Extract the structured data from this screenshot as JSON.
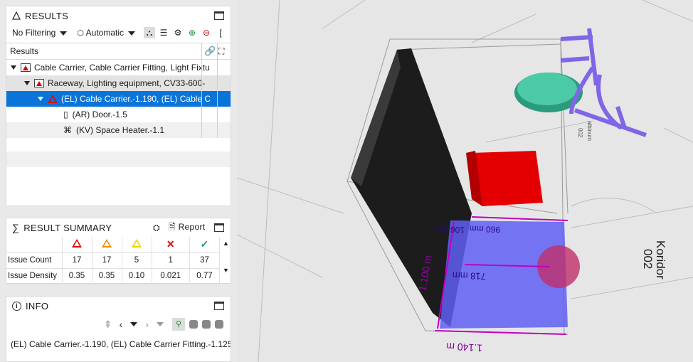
{
  "results_panel": {
    "title": "RESULTS",
    "filter_label": "No Filtering",
    "mode_label": "Automatic",
    "column_header": "Results",
    "rows": [
      {
        "label": "Cable Carrier, Cable Carrier Fitting, Light Fixtu"
      },
      {
        "label": "Raceway, Lighting equipment, CV33-600-"
      },
      {
        "label": "(EL) Cable Carrier.-1.190, (EL) Cable C"
      },
      {
        "label": "(AR) Door.-1.5"
      },
      {
        "label": "(KV) Space Heater.-1.1"
      }
    ]
  },
  "summary_panel": {
    "title": "RESULT SUMMARY",
    "report_label": "Report",
    "severity_colors": [
      "#e00000",
      "#f08a00",
      "#f0d000",
      "#e00000",
      "#19a05a"
    ],
    "rows": [
      {
        "label": "Issue Count",
        "values": [
          "17",
          "17",
          "5",
          "1",
          "37"
        ]
      },
      {
        "label": "Issue Density",
        "values": [
          "0.35",
          "0.35",
          "0.10",
          "0.021",
          "0.77"
        ]
      }
    ]
  },
  "info_panel": {
    "title": "INFO",
    "selection_text": "(EL) Cable Carrier.-1.190, (EL) Cable Carrier Fitting.-1.125..."
  },
  "viewport": {
    "room_label_line1": "Koridor",
    "room_label_line2": "002",
    "small_label": "002",
    "small_label2": "albinum",
    "dim_height": "1.100 m",
    "dim_width": "1.140 m",
    "dim_inner": "718 mm",
    "dim_top": "960 mm",
    "dim_top2": "106 mm",
    "colors": {
      "highlight": "#5f5ff5",
      "dimension": "#c000c0",
      "obstacle": "#e00000",
      "cable": "#8a6de0",
      "fixture": "#3fb89a"
    }
  }
}
